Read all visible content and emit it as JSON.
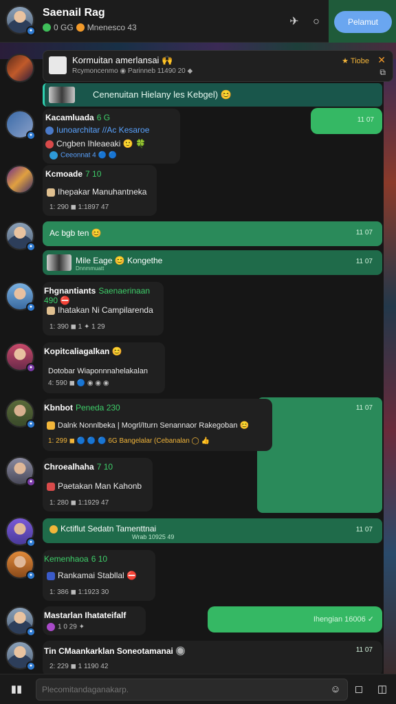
{
  "header": {
    "title": "Saenail Rag",
    "subtitle": "Mnenesco 43",
    "subtitle_prefix": "0 GG",
    "cta_label": "Pelamut"
  },
  "pinned": {
    "title": "Kormuitan amerlansai 🙌",
    "sub": "Rcymoncenmo ◉ Parinneb 11490 20 ◆",
    "tag": "★ Tiobe",
    "close": "✕",
    "expand": "⧉"
  },
  "reply_strip": {
    "text": "Cenenuitan Hielany les Kebgel) 😊"
  },
  "messages": [
    {
      "name": "Kacamluada",
      "tag": "6 G",
      "lines": [
        "Iunoarchitar //Ac Kesaroe",
        "Cngben Ihleaeaki 🙂 🍀",
        "Ceeonnat 4 🔵 🔵"
      ],
      "time": "11 07"
    },
    {
      "name": "Kcmoade",
      "tag": "7 10",
      "lines": [
        "Ihepakar Manuhantneka",
        "1: 290 ◼ 1:1897 47"
      ]
    },
    {
      "text": "Ac bgb ten 😊",
      "time": "11 07"
    },
    {
      "text": "Mile Eage 😊 Kongethe",
      "sub": "Dnnmmuatt",
      "time": "11 07"
    },
    {
      "name": "Fhgnantiants",
      "tag": "Saenaerinaan 490 ⛔",
      "lines": [
        "Ihatakan Ni Campilarenda",
        "1: 390 ◼ 1 ✦ 1 29"
      ]
    },
    {
      "name": "Kopitcaliagalkan 😊",
      "lines": [
        "Dotobar Wiaponnnahelakalan",
        "4: 590 ◼ 🔵 ◉ ◉ ◉"
      ]
    },
    {
      "name": "Kbnbot",
      "tag": "Peneda 230",
      "lines": [
        "Dalnk Nonnlbeka | Mogrl/Iturn Senannaor Rakegoban 😊",
        "1: 299 ◼ 🔵 🔵 🔵 6G Bangelalar (Cebanalan ◯ 👍"
      ],
      "time": "11 07"
    },
    {
      "name": "Chroealhaha",
      "tag": "7 10",
      "lines": [
        "Paetakan Man Kahonb",
        "1: 280 ◼ 1:1929 47"
      ]
    },
    {
      "text": "Kctiflut Sedatn Tamenttnai",
      "sub": "Wrab 10925 49",
      "time": "11 07"
    },
    {
      "name": "Kemenhaoa",
      "tag": "6 10",
      "lines": [
        "Rankamai Stabllal ⛔",
        "1: 386 ◼ 1:1923 30"
      ]
    },
    {
      "name": "Mastarlan Ihatateifalf",
      "lines": [
        "1 0 29 ✦"
      ]
    },
    {
      "text": "Ihengian 16006 ✓",
      "time": ""
    },
    {
      "name": "Tin CMaankarklan Soneotamanai 🔘",
      "lines": [
        "2: 229 ◼ 1 1190 42"
      ],
      "time": "11 07"
    }
  ],
  "input": {
    "placeholder": "Plecomitandaganakarp."
  },
  "icons": {
    "header_pin": "pin-icon",
    "header_circle": "circle-icon",
    "bottom_book": "book-icon",
    "bottom_emoji": "emoji-icon",
    "bottom_square": "square-icon",
    "bottom_camera": "camera-icon"
  },
  "colors": {
    "green_bubble": "#35b864",
    "green_dark": "#1f6b4a",
    "accent_blue": "#6aa6f0",
    "online": "#3fbf5a"
  }
}
